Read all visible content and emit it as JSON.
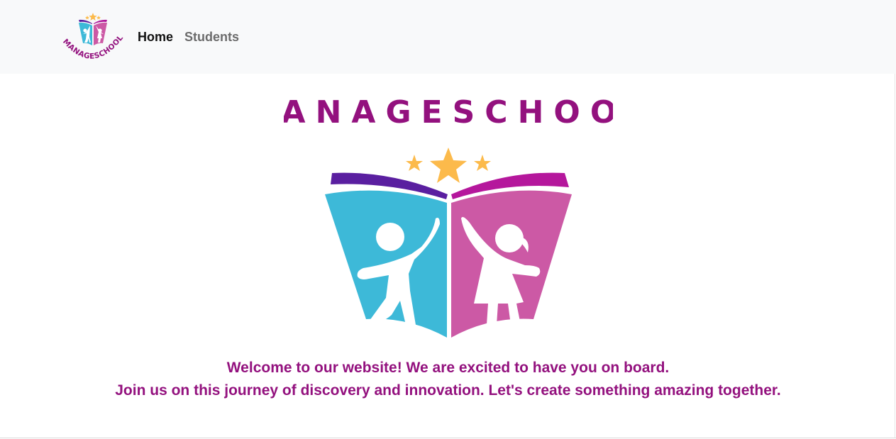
{
  "brand": {
    "name": "MANAGESCHOOL",
    "logo_icon": "open-book-children-stars-logo"
  },
  "nav": {
    "items": [
      {
        "label": "Home",
        "active": true
      },
      {
        "label": "Students",
        "active": false
      }
    ]
  },
  "hero": {
    "wordmark": "MANAGESCHOOL",
    "welcome_line1": "Welcome to our website! We are excited to have you on board.",
    "welcome_line2": "Join us on this journey of discovery and innovation. Let's create something amazing together."
  },
  "colors": {
    "brand_purple": "#93117e",
    "book_blue": "#3db9d8",
    "book_pink": "#cc59a5",
    "star_yellow": "#fcba4b",
    "navbar_bg": "#f8f9fa"
  }
}
